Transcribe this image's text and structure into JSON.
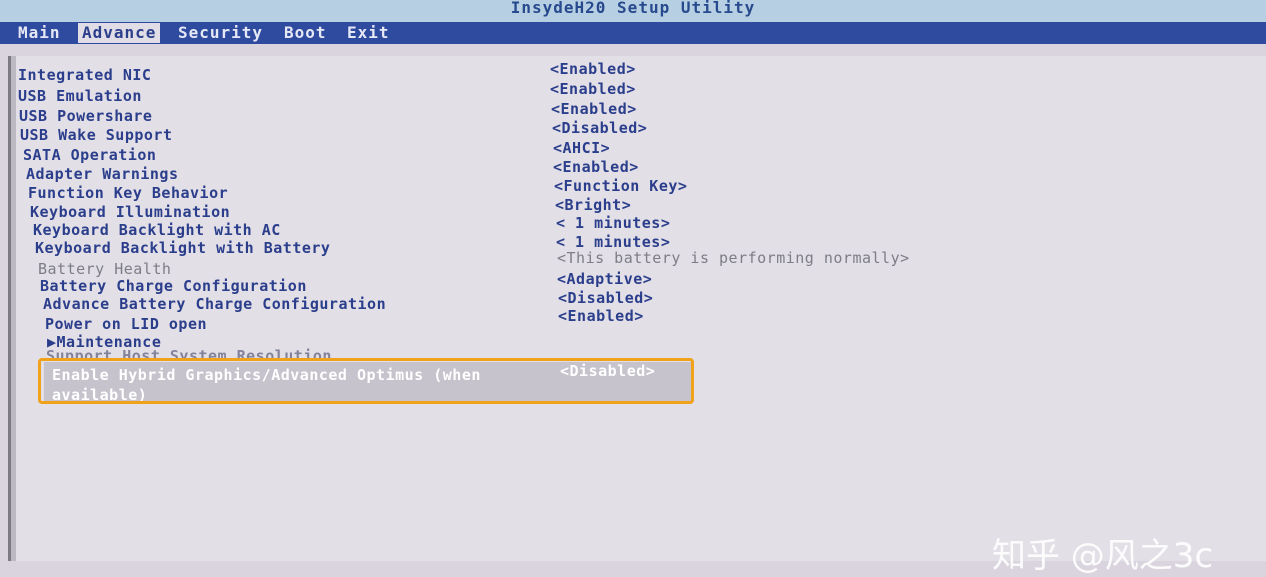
{
  "window": {
    "title": "InsydeH20 Setup Utility"
  },
  "menu": {
    "tabs": [
      {
        "label": "Main"
      },
      {
        "label": "Advance"
      },
      {
        "label": "Security"
      },
      {
        "label": "Boot"
      },
      {
        "label": "Exit"
      }
    ],
    "active": "Advance"
  },
  "settings": [
    {
      "label": "Integrated NIC",
      "value": "<Enabled>"
    },
    {
      "label": "USB Emulation",
      "value": "<Enabled>"
    },
    {
      "label": "USB Powershare",
      "value": "<Enabled>"
    },
    {
      "label": "USB Wake Support",
      "value": "<Disabled>"
    },
    {
      "label": "SATA Operation",
      "value": "<AHCI>"
    },
    {
      "label": "Adapter Warnings",
      "value": "<Enabled>"
    },
    {
      "label": "Function Key Behavior",
      "value": "<Function Key>"
    },
    {
      "label": "Keyboard Illumination",
      "value": "<Bright>"
    },
    {
      "label": "Keyboard Backlight with AC",
      "value": "< 1 minutes>"
    },
    {
      "label": "Keyboard Backlight with Battery",
      "value": "< 1 minutes>"
    },
    {
      "label": "Battery Health",
      "value": "<This battery is performing normally>",
      "disabled": true
    },
    {
      "label": "Battery Charge Configuration",
      "value": "<Adaptive>"
    },
    {
      "label": "Advance Battery Charge Configuration",
      "value": "<Disabled>"
    },
    {
      "label": "Power on LID open",
      "value": "<Enabled>"
    }
  ],
  "submenu": {
    "label": "▶Maintenance"
  },
  "obscured_item": {
    "label": "Support Host System Resolution"
  },
  "selected": {
    "label_line1": "Enable Hybrid Graphics/Advanced Optimus (when",
    "label_line2": "available)",
    "value": "<Disabled>"
  },
  "watermark": {
    "text": "知乎 @风之3c"
  },
  "colors": {
    "menu_bar": "#2f4ba0",
    "text": "#2b3e8c",
    "highlight_border": "#f0a21a",
    "background": "#e2dfe6"
  }
}
